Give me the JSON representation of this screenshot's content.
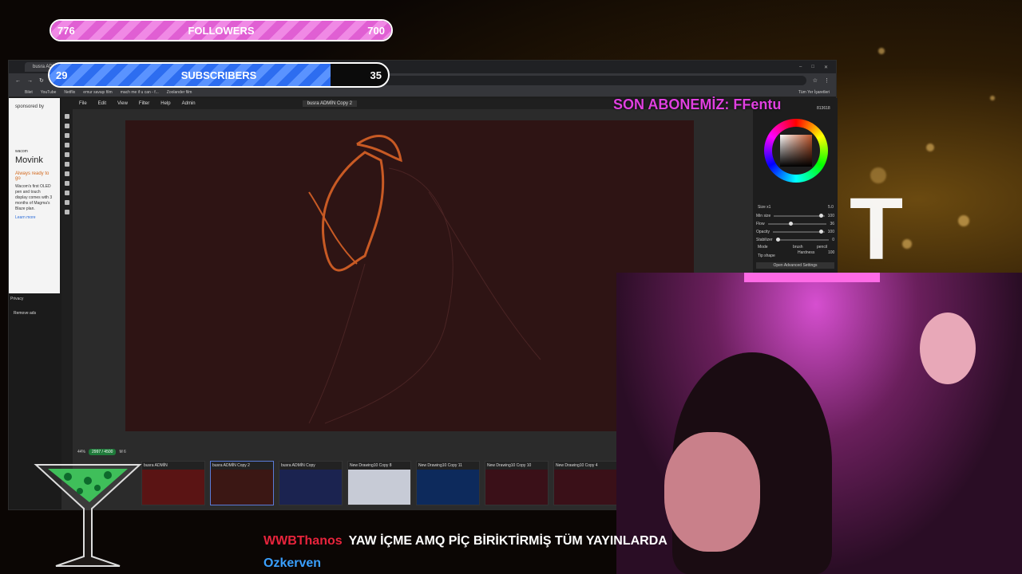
{
  "overlays": {
    "followers": {
      "current": "776",
      "label": "FOLLOWERS",
      "goal": "700",
      "progress_percent": 100
    },
    "subscribers": {
      "current": "29",
      "label": "SUBSCRIBERS",
      "goal": "35",
      "progress_percent": 83
    },
    "last_subscriber": "SON ABONEMİZ: FFentu"
  },
  "browser": {
    "tab_title": "busra ADMİN",
    "url": "",
    "bookmarks": [
      "Bilet",
      "YouTube",
      "Netflix",
      "emur savaşı film",
      "mach me if u can - f...",
      "Zoolander film"
    ],
    "bookmarks_right": "Tüm Yer İşaretleri"
  },
  "ad": {
    "label": "sponsored by",
    "brand_small": "wacom",
    "brand": "Movink",
    "headline": "Always ready to go",
    "body": "Wacom's first OLED pen and touch display comes with 3 months of Magma's Blaze plan.",
    "cta": "Learn more"
  },
  "sidebar": {
    "privacy": "Privacy",
    "remove_ads": "Remove ads"
  },
  "app": {
    "menu": [
      "File",
      "Edit",
      "View",
      "Filter",
      "Help",
      "Admin"
    ],
    "doc_title": "busra ADMİN Copy 2",
    "zoom": "44%",
    "canvas_size": "2997 / 4500",
    "brush_label": "M 6",
    "color_hex": "813618",
    "panel": {
      "size_label": "Size x1",
      "rows": [
        {
          "label": "Min size",
          "value": "100"
        },
        {
          "label": "Flow",
          "value": "36"
        },
        {
          "label": "Opacity",
          "value": "100"
        },
        {
          "label": "Stabilizer",
          "value": "0"
        }
      ],
      "mode_label": "Mode",
      "mode_brush": "brush",
      "mode_pencil": "pencil",
      "tip_shape": "Tip shape",
      "hardness_label": "Hardness",
      "hardness_value": "100",
      "size_value": "5.0",
      "advanced": "Open Advanced Settings"
    },
    "thumbnails": [
      {
        "label": "busra ADMİN",
        "color": "#5a1414"
      },
      {
        "label": "busra ADMİN Copy 2",
        "color": "#3b1714"
      },
      {
        "label": "busra ADMİN Copy",
        "color": "#1b2350"
      },
      {
        "label": "New Drawing10 Copy 8",
        "color": "#c7cbd6"
      },
      {
        "label": "New Drawing10 Copy 11",
        "color": "#0d2a5c"
      },
      {
        "label": "New Drawing10 Copy 10",
        "color": "#3a1018"
      },
      {
        "label": "New Drawing10 Copy 4",
        "color": "#3a1018"
      }
    ]
  },
  "chat": [
    {
      "user": "WWBThanos",
      "message": "YAW İÇME AMQ PİÇ BİRİKTİRMİŞ TÜM YAYINLARDA"
    },
    {
      "user": "Ozkerven",
      "message": ""
    }
  ],
  "letter": "T"
}
